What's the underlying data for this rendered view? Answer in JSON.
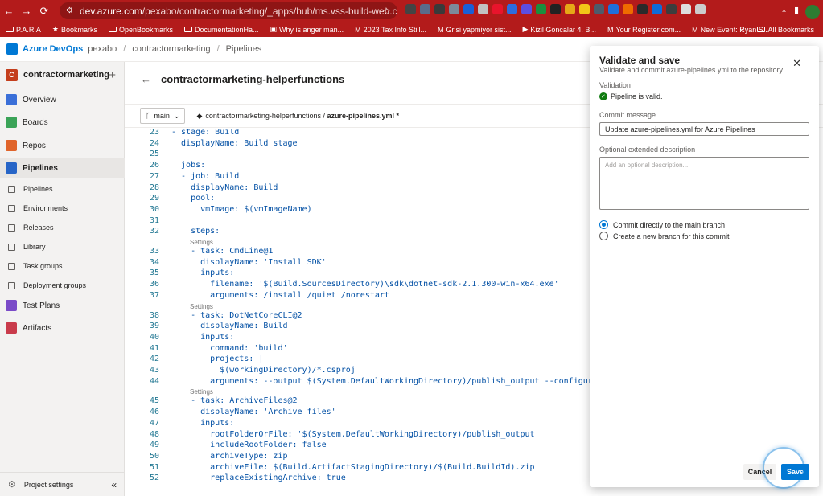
{
  "browser": {
    "url_domain": "dev.azure.com",
    "url_path": "/pexabo/contractormarketing/_apps/hub/ms.vss-build-web.ci-designer-hub?pip...",
    "bookmarks": [
      "P.A.R.A",
      "Bookmarks",
      "OpenBookmarks",
      "DocumentationHa...",
      "Why is anger man...",
      "2023 Tax Info Still...",
      "Grisi yapmiyor sist...",
      "Kizil Goncalar 4. B...",
      "Your Register.com...",
      "New Event: Ryan S..."
    ],
    "all_bookmarks": "All Bookmarks",
    "colors": {
      "bar": "#b31b1b"
    }
  },
  "topbar": {
    "brand": "Azure DevOps",
    "org": "pexabo",
    "project": "contractormarketing",
    "section": "Pipelines"
  },
  "sidebar": {
    "project_initial": "C",
    "project_name": "contractormarketing",
    "items": [
      {
        "label": "Overview",
        "color": "#3a6fd8"
      },
      {
        "label": "Boards",
        "color": "#3aa357"
      },
      {
        "label": "Repos",
        "color": "#e0642a"
      },
      {
        "label": "Pipelines",
        "color": "#2765c7"
      },
      {
        "label": "Pipelines",
        "color": ""
      },
      {
        "label": "Environments",
        "color": ""
      },
      {
        "label": "Releases",
        "color": ""
      },
      {
        "label": "Library",
        "color": ""
      },
      {
        "label": "Task groups",
        "color": ""
      },
      {
        "label": "Deployment groups",
        "color": ""
      },
      {
        "label": "Test Plans",
        "color": "#7a4bc8"
      },
      {
        "label": "Artifacts",
        "color": "#c93b4b"
      }
    ],
    "settings": "Project settings"
  },
  "main": {
    "title": "contractormarketing-helperfunctions",
    "branch": "main",
    "repo": "contractormarketing-helperfunctions",
    "file": "azure-pipelines.yml *"
  },
  "editor": {
    "lines": [
      {
        "n": "23",
        "text": "- stage: Build"
      },
      {
        "n": "24",
        "text": "  displayName: Build stage"
      },
      {
        "n": "25",
        "text": ""
      },
      {
        "n": "26",
        "text": "  jobs:"
      },
      {
        "n": "27",
        "text": "  - job: Build"
      },
      {
        "n": "28",
        "text": "    displayName: Build"
      },
      {
        "n": "29",
        "text": "    pool:"
      },
      {
        "n": "30",
        "text": "      vmImage: $(vmImageName)"
      },
      {
        "n": "31",
        "text": ""
      },
      {
        "n": "32",
        "text": "    steps:"
      },
      {
        "n": "33",
        "text": "    - task: CmdLine@1"
      },
      {
        "n": "34",
        "text": "      displayName: 'Install SDK'"
      },
      {
        "n": "35",
        "text": "      inputs:"
      },
      {
        "n": "36",
        "text": "        filename: '$(Build.SourcesDirectory)\\sdk\\dotnet-sdk-2.1.300-win-x64.exe'"
      },
      {
        "n": "37",
        "text": "        arguments: /install /quiet /norestart"
      },
      {
        "n": "38",
        "text": "    - task: DotNetCoreCLI@2"
      },
      {
        "n": "39",
        "text": "      displayName: Build"
      },
      {
        "n": "40",
        "text": "      inputs:"
      },
      {
        "n": "41",
        "text": "        command: 'build'"
      },
      {
        "n": "42",
        "text": "        projects: |"
      },
      {
        "n": "43",
        "text": "          $(workingDirectory)/*.csproj"
      },
      {
        "n": "44",
        "text": "        arguments: --output $(System.DefaultWorkingDirectory)/publish_output --configuration R"
      },
      {
        "n": "45",
        "text": "    - task: ArchiveFiles@2"
      },
      {
        "n": "46",
        "text": "      displayName: 'Archive files'"
      },
      {
        "n": "47",
        "text": "      inputs:"
      },
      {
        "n": "48",
        "text": "        rootFolderOrFile: '$(System.DefaultWorkingDirectory)/publish_output'"
      },
      {
        "n": "49",
        "text": "        includeRootFolder: false"
      },
      {
        "n": "50",
        "text": "        archiveType: zip"
      },
      {
        "n": "51",
        "text": "        archiveFile: $(Build.ArtifactStagingDirectory)/$(Build.BuildId).zip"
      },
      {
        "n": "52",
        "text": "        replaceExistingArchive: true"
      }
    ],
    "settings_lens": "Settings"
  },
  "panel": {
    "title": "Validate and save",
    "subtitle": "Validate and commit azure-pipelines.yml to the repository.",
    "validation_label": "Validation",
    "validation_status": "Pipeline is valid.",
    "commit_label": "Commit message",
    "commit_value": "Update azure-pipelines.yml for Azure Pipelines",
    "desc_label": "Optional extended description",
    "desc_placeholder": "Add an optional description...",
    "radio_main": "Commit directly to the main branch",
    "radio_new": "Create a new branch for this commit",
    "cancel": "Cancel",
    "save": "Save"
  }
}
